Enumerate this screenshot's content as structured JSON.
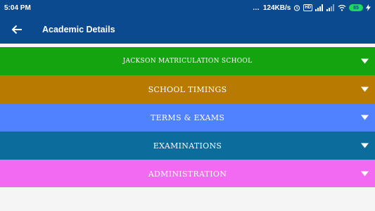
{
  "status_bar": {
    "time": "5:04 PM",
    "speed": "124KB/s",
    "battery": "85",
    "icons": [
      "more-dots-icon",
      "alarm-icon",
      "volte-icon",
      "signal-icon",
      "signal-icon",
      "wifi-icon",
      "battery-icon",
      "charging-icon"
    ]
  },
  "app_bar": {
    "back_icon": "arrow-left-icon",
    "title": "Academic Details"
  },
  "sections": [
    {
      "label": "JACKSON MATRICULATION SCHOOL",
      "color": "#14a40f",
      "icon": "chevron-down-icon"
    },
    {
      "label": "SCHOOL TIMINGS",
      "color": "#b87a00",
      "icon": "chevron-down-icon"
    },
    {
      "label": "TERMS & EXAMS",
      "color": "#5082ff",
      "icon": "chevron-down-icon"
    },
    {
      "label": "EXAMINATIONS",
      "color": "#0c6c9c",
      "icon": "chevron-down-icon"
    },
    {
      "label": "ADMINISTRATION",
      "color": "#f26af2",
      "icon": "chevron-down-icon"
    }
  ]
}
